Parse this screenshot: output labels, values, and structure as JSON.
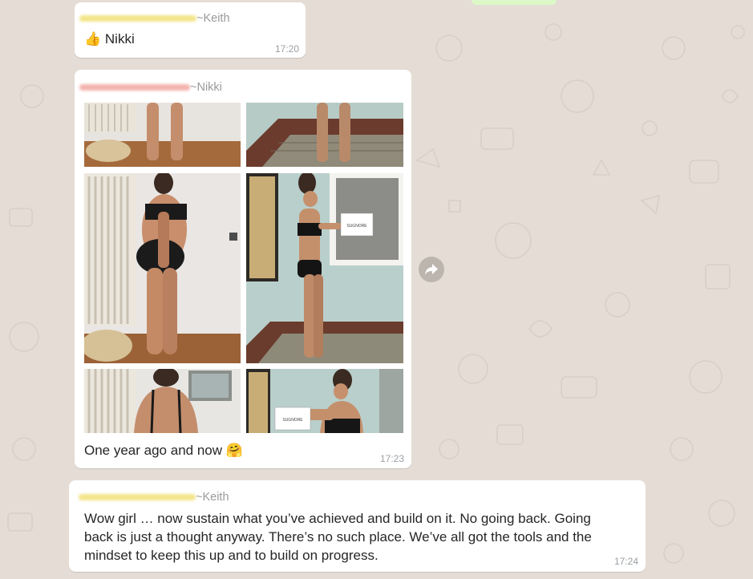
{
  "messages": [
    {
      "sender": "~Keith",
      "text": "Nikki",
      "emoji": "👍",
      "time": "17:20"
    },
    {
      "sender": "~Nikki",
      "caption": "One year ago and now",
      "emoji": "🤗",
      "time": "17:23",
      "media": {
        "card_text": "SUGNORE"
      }
    },
    {
      "sender": "~Keith",
      "text": "Wow girl … now sustain what you’ve achieved and build on it. No going back. Going back is just a thought anyway. There’s no such place. We’ve all got the tools and the mindset to keep this up and to build on progress.",
      "time": "17:24"
    }
  ],
  "icons": {
    "forward": "forward-arrow-icon",
    "reaction_1": "thumbs-up-emoji",
    "reaction_2": "hugging-face-emoji"
  },
  "colors": {
    "wallpaper": "#e5ddd5",
    "bubble": "#ffffff",
    "outgoing_bubble": "#dcf8c6",
    "sender_keith_blur": "#f3e58a",
    "sender_nikki_blur": "#f4b4ad"
  }
}
